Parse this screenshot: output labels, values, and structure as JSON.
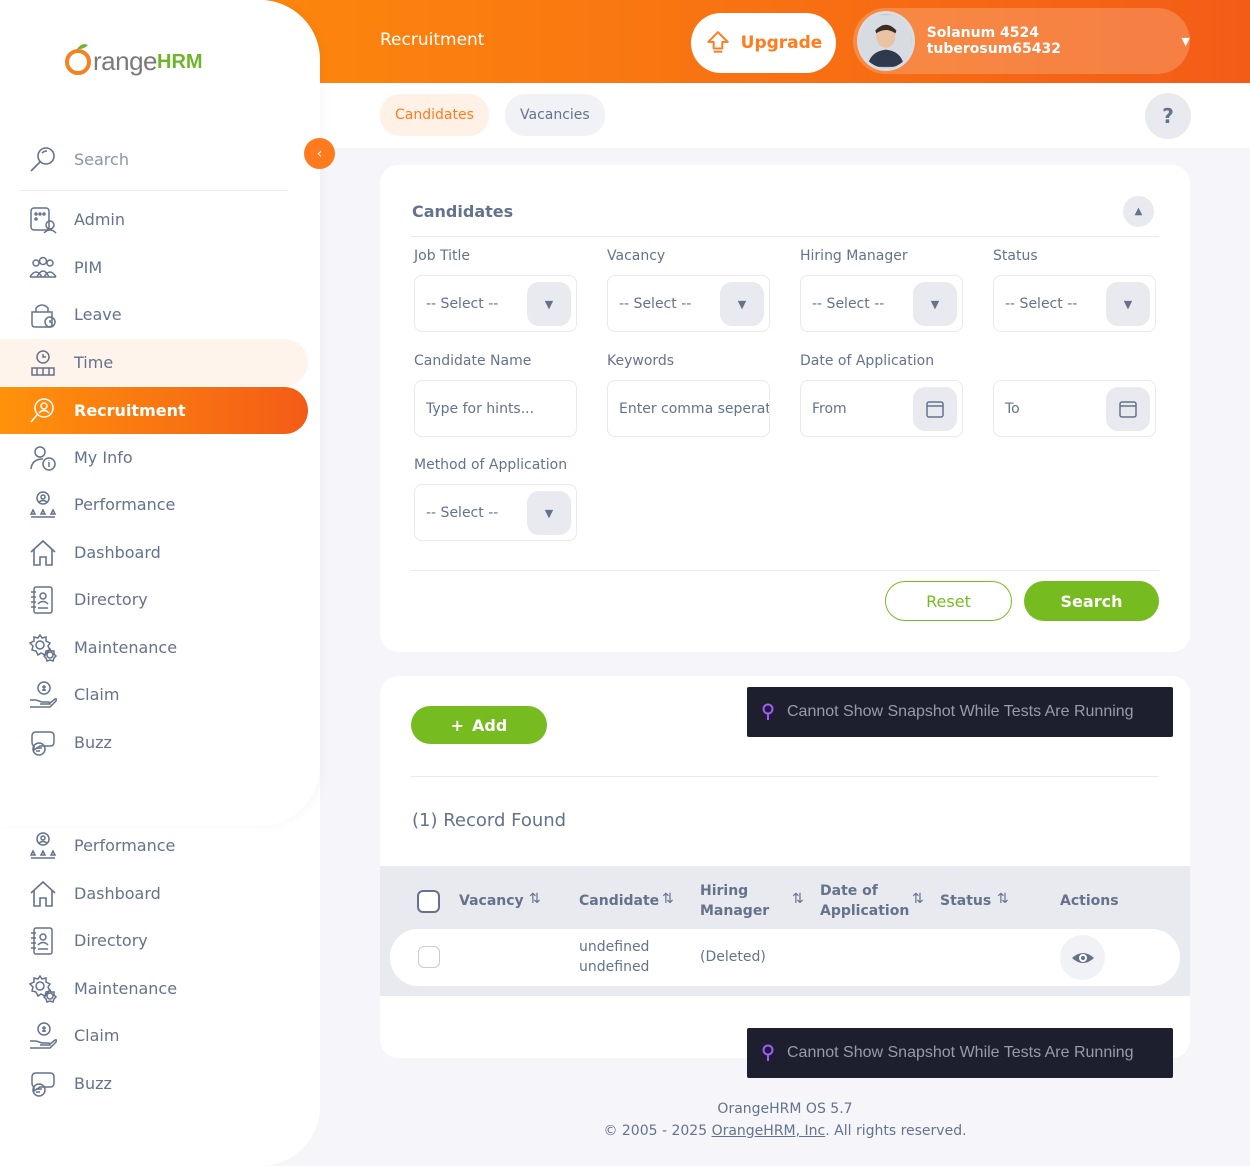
{
  "header": {
    "module_title": "Recruitment",
    "upgrade_label": "Upgrade",
    "user_name": "Solanum 4524 tuberosum65432"
  },
  "subnav": {
    "tabs": [
      {
        "label": "Candidates",
        "active": true
      },
      {
        "label": "Vacancies",
        "active": false
      }
    ],
    "help_label": "?"
  },
  "sidebar": {
    "brand": {
      "name": "range",
      "suffix": "HRM"
    },
    "search_label": "Search",
    "items": [
      {
        "label": "Admin",
        "icon": "admin-icon"
      },
      {
        "label": "PIM",
        "icon": "pim-icon"
      },
      {
        "label": "Leave",
        "icon": "leave-icon"
      },
      {
        "label": "Time",
        "icon": "time-icon"
      },
      {
        "label": "Recruitment",
        "icon": "recruitment-icon"
      },
      {
        "label": "My Info",
        "icon": "my-info-icon"
      },
      {
        "label": "Performance",
        "icon": "performance-icon"
      },
      {
        "label": "Dashboard",
        "icon": "dashboard-icon"
      },
      {
        "label": "Directory",
        "icon": "directory-icon"
      },
      {
        "label": "Maintenance",
        "icon": "maintenance-icon"
      },
      {
        "label": "Claim",
        "icon": "claim-icon"
      },
      {
        "label": "Buzz",
        "icon": "buzz-icon"
      }
    ],
    "extra_items": [
      {
        "label": "Performance"
      },
      {
        "label": "Dashboard"
      },
      {
        "label": "Directory"
      },
      {
        "label": "Maintenance"
      },
      {
        "label": "Claim"
      },
      {
        "label": "Buzz"
      }
    ]
  },
  "filter": {
    "title": "Candidates",
    "job_title": {
      "label": "Job Title",
      "value": "-- Select --"
    },
    "vacancy": {
      "label": "Vacancy",
      "value": "-- Select --"
    },
    "hiring_manager": {
      "label": "Hiring Manager",
      "value": "-- Select --"
    },
    "status": {
      "label": "Status",
      "value": "-- Select --"
    },
    "candidate_name": {
      "label": "Candidate Name",
      "placeholder": "Type for hints..."
    },
    "keywords": {
      "label": "Keywords",
      "placeholder": "Enter comma seperat"
    },
    "date_of_application": {
      "label": "Date of Application",
      "from_placeholder": "From",
      "to_placeholder": "To"
    },
    "method": {
      "label": "Method of Application",
      "value": "-- Select --"
    },
    "reset_label": "Reset",
    "search_label": "Search"
  },
  "results": {
    "add_label": "Add",
    "records_label": "(1) Record Found",
    "columns": [
      {
        "line1": "Vacancy",
        "line2": ""
      },
      {
        "line1": "Candidate",
        "line2": ""
      },
      {
        "line1": "Hiring",
        "line2": "Manager"
      },
      {
        "line1": "Date of",
        "line2": "Application"
      },
      {
        "line1": "Status",
        "line2": ""
      },
      {
        "line1": "Actions",
        "line2": ""
      }
    ],
    "rows": [
      {
        "vacancy": "",
        "candidate_line1": "undefined",
        "candidate_line2": "undefined",
        "hiring_manager": "(Deleted)",
        "date": "",
        "status": ""
      }
    ]
  },
  "snapshot_message": "Cannot Show Snapshot While Tests Are Running",
  "footer": {
    "version": "OrangeHRM OS 5.7",
    "copyright_prefix": "© 2005 - 2025 ",
    "company_link": "OrangeHRM, Inc",
    "copyright_suffix": ". All rights reserved."
  },
  "colors": {
    "accent": "#ff7b1d",
    "green": "#76bc21",
    "text": "#64728c"
  }
}
